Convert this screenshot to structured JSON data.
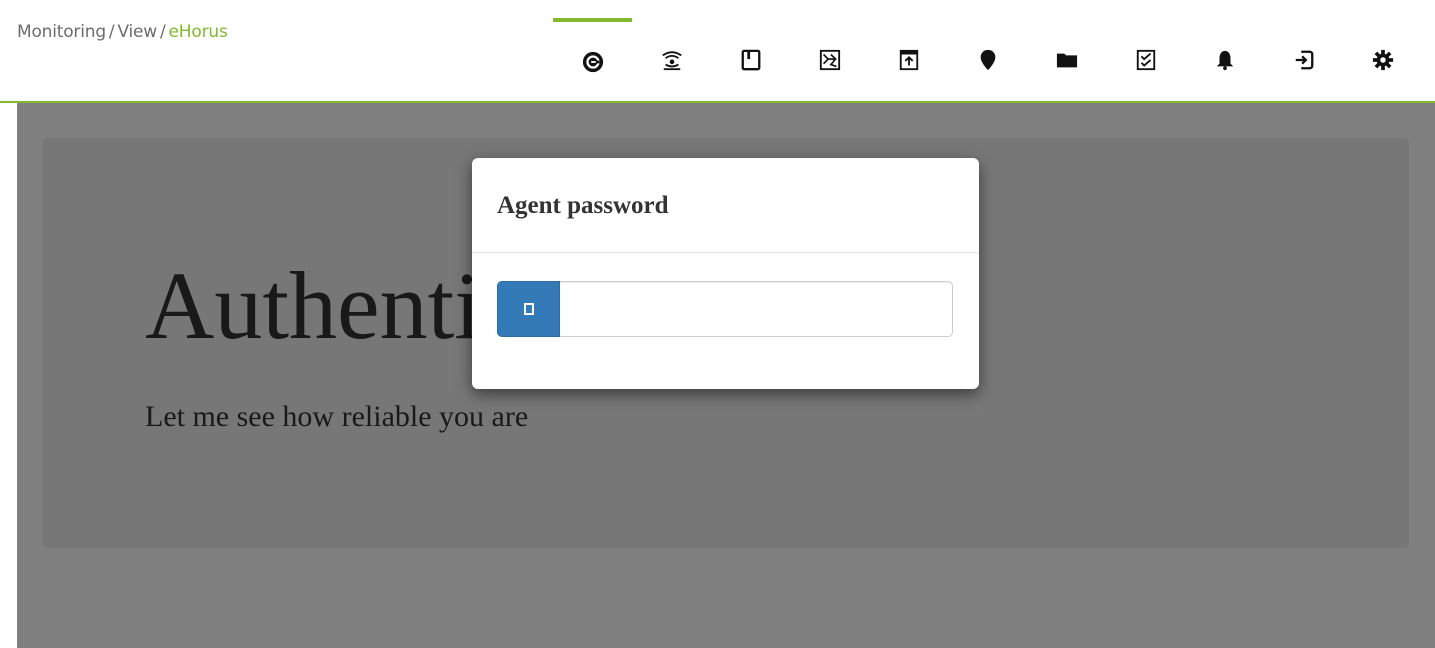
{
  "breadcrumb": {
    "items": [
      "Monitoring",
      "View"
    ],
    "separator": "/",
    "current": "eHorus"
  },
  "tabs": [
    {
      "name": "ehorus-icon",
      "active": true
    },
    {
      "name": "network-icon",
      "active": false
    },
    {
      "name": "book-icon",
      "active": false
    },
    {
      "name": "chart-icon",
      "active": false
    },
    {
      "name": "module-icon",
      "active": false
    },
    {
      "name": "location-pin-icon",
      "active": false
    },
    {
      "name": "folder-icon",
      "active": false
    },
    {
      "name": "checklist-icon",
      "active": false
    },
    {
      "name": "bell-icon",
      "active": false
    },
    {
      "name": "login-icon",
      "active": false
    },
    {
      "name": "gear-icon",
      "active": false
    }
  ],
  "jumbotron": {
    "title": "Authentication",
    "subtitle": "Let me see how reliable you are"
  },
  "modal": {
    "title": "Agent password",
    "password_value": "",
    "button_icon": "eye-icon"
  },
  "colors": {
    "accent": "#82b92e",
    "primary": "#337ab7",
    "overlay": "rgba(0,0,0,0.5)"
  }
}
